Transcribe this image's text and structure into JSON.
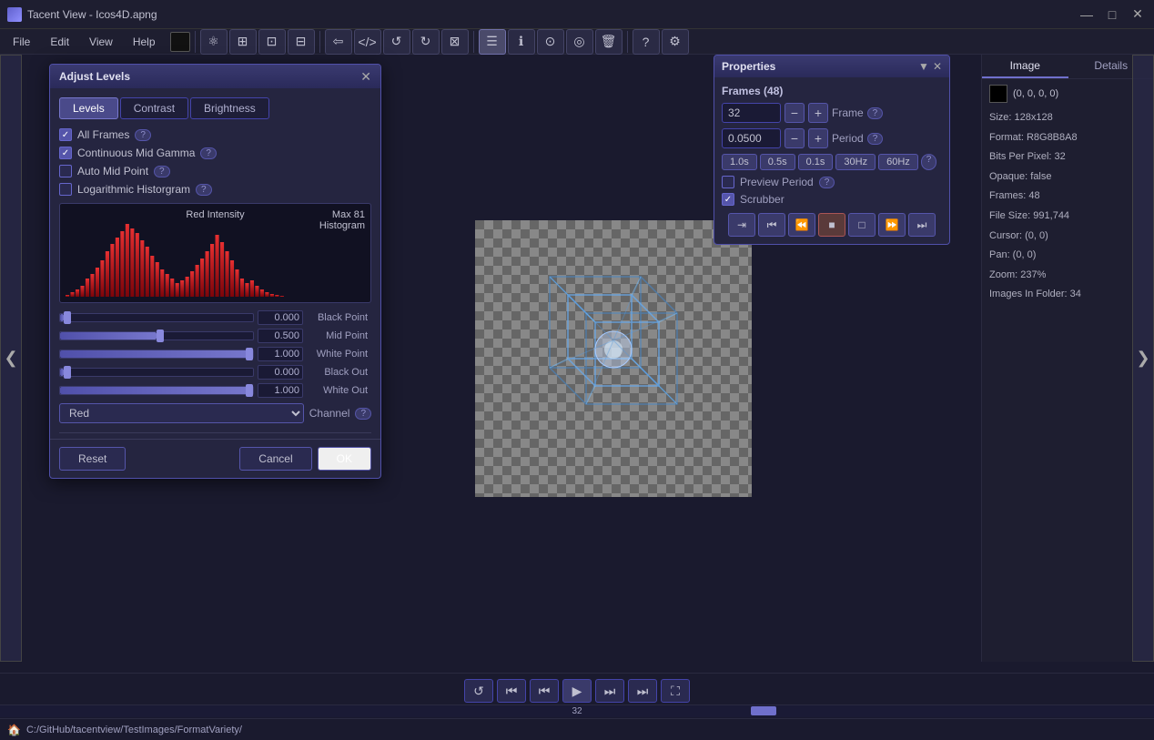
{
  "window": {
    "title": "Tacent View - Icos4D.apng",
    "close": "✕",
    "minimize": "—",
    "maximize": "□"
  },
  "menubar": {
    "items": [
      "File",
      "Edit",
      "View",
      "Help"
    ]
  },
  "toolbar": {
    "color_swatch": "#111111",
    "buttons": [
      "⊕",
      "⊞",
      "⊡",
      "⊟",
      "←",
      "</>",
      "↺",
      "↻",
      "⊠",
      "≡",
      "ℹ",
      "⊙",
      "◎",
      "🗑",
      "?",
      "⚙"
    ]
  },
  "dialog": {
    "title": "Adjust Levels",
    "tabs": [
      "Levels",
      "Contrast",
      "Brightness"
    ],
    "active_tab": "Levels",
    "checkboxes": [
      {
        "label": "All Frames",
        "checked": true,
        "help": "?"
      },
      {
        "label": "Continuous Mid Gamma",
        "checked": true,
        "help": "?"
      },
      {
        "label": "Auto Mid Point",
        "checked": false,
        "help": "?"
      },
      {
        "label": "Logarithmic Historgram",
        "checked": false,
        "help": "?"
      }
    ],
    "histogram": {
      "label": "Red Intensity",
      "max_label": "Max 81",
      "histogram_label": "Histogram"
    },
    "sliders": [
      {
        "label": "Black Point",
        "value": "0.000",
        "pct": 2
      },
      {
        "label": "Mid Point",
        "value": "0.500",
        "pct": 50
      },
      {
        "label": "White Point",
        "value": "1.000",
        "pct": 100
      },
      {
        "label": "Black Out",
        "value": "0.000",
        "pct": 2
      },
      {
        "label": "White Out",
        "value": "1.000",
        "pct": 100
      }
    ],
    "channel": {
      "label": "Channel",
      "value": "Red",
      "help": "?"
    },
    "buttons": {
      "reset": "Reset",
      "cancel": "Cancel",
      "ok": "OK"
    }
  },
  "properties": {
    "title": "Properties",
    "frames_label": "Frames (48)",
    "frame_value": "32",
    "period_value": "0.0500",
    "frame_label": "Frame",
    "period_label": "Period",
    "help": "?",
    "time_buttons": [
      "1.0s",
      "0.5s",
      "0.1s",
      "30Hz",
      "60Hz"
    ],
    "preview_period": {
      "label": "Preview Period",
      "checked": false,
      "help": "?"
    },
    "scrubber": {
      "label": "Scrubber",
      "checked": true
    },
    "transport": [
      "⏭",
      "⏮",
      "⏮",
      "■",
      "□",
      "⏭",
      "⏭"
    ]
  },
  "info_panel": {
    "tabs": [
      "Image",
      "Details"
    ],
    "active_tab": "Image",
    "color": "(0, 0, 0, 0)",
    "size": "Size: 128x128",
    "format": "Format: R8G8B8A8",
    "bpp": "Bits Per Pixel: 32",
    "opaque": "Opaque: false",
    "frames": "Frames: 48",
    "filesize": "File Size: 991,744",
    "cursor": "Cursor: (0, 0)",
    "pan": "Pan: (0, 0)",
    "zoom": "Zoom: 237%",
    "images_in_folder": "Images In Folder: 34"
  },
  "playback": {
    "buttons": [
      "↺",
      "⏮",
      "⏮",
      "▶",
      "⏭",
      "⏭",
      "⛶"
    ],
    "frame": "32"
  },
  "statusbar": {
    "path": "C:/GitHub/tacentview/TestImages/FormatVariety/"
  }
}
